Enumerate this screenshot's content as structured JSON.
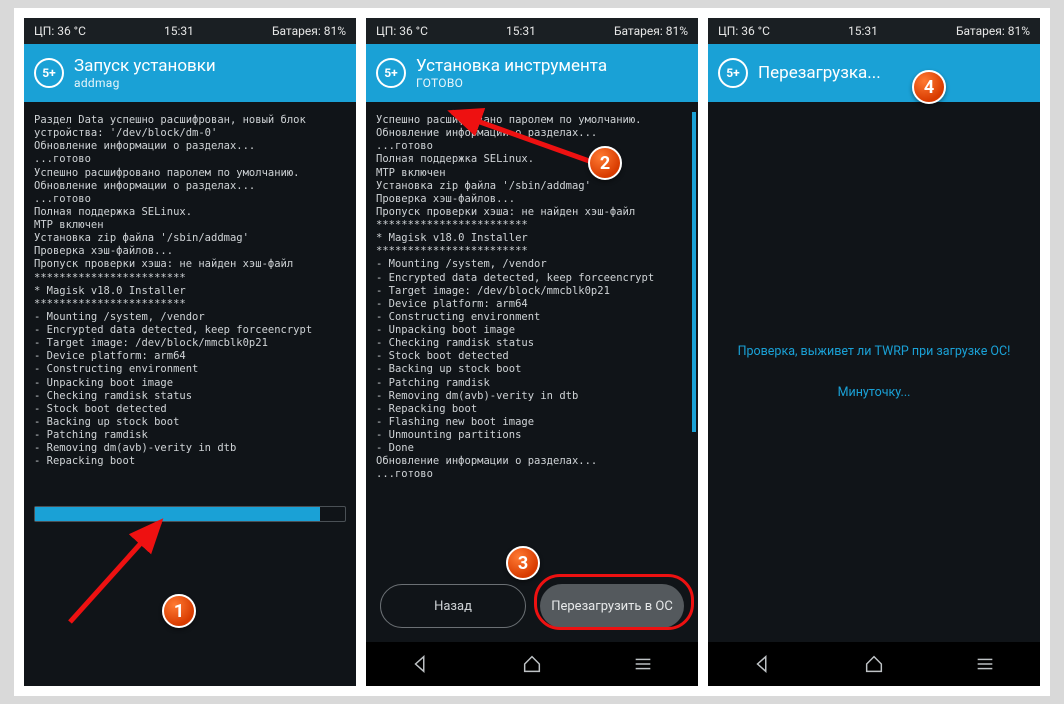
{
  "status": {
    "cpu": "ЦП: 36 °C",
    "time": "15:31",
    "battery": "Батарея: 81%"
  },
  "badge": "5+",
  "nav": {
    "back": "back",
    "home": "home",
    "recent": "recent"
  },
  "annotations": {
    "n1": "1",
    "n2": "2",
    "n3": "3",
    "n4": "4"
  },
  "screen1": {
    "title": "Запуск установки",
    "subtitle": "addmag",
    "log": "Раздел Data успешно расшифрован, новый блок\nустройства: '/dev/block/dm-0'\nОбновление информации о разделах...\n...готово\nУспешно расшифровано паролем по умолчанию.\nОбновление информации о разделах...\n...готово\nПолная поддержка SELinux.\nMTP включен\nУстановка zip файла '/sbin/addmag'\nПроверка хэш-файлов...\nПропуск проверки хэша: не найден хэш-файл\n************************\n* Magisk v18.0 Installer\n************************\n- Mounting /system, /vendor\n- Encrypted data detected, keep forceencrypt\n- Target image: /dev/block/mmcblk0p21\n- Device platform: arm64\n- Constructing environment\n- Unpacking boot image\n- Checking ramdisk status\n- Stock boot detected\n- Backing up stock boot\n- Patching ramdisk\n- Removing dm(avb)-verity in dtb\n- Repacking boot",
    "progress_pct": 92
  },
  "screen2": {
    "title": "Установка инструмента",
    "subtitle": "ГОТОВО",
    "log": "Успешно расшифровано паролем по умолчанию.\nОбновление информации о разделах...\n...готово\nПолная поддержка SELinux.\nMTP включен\nУстановка zip файла '/sbin/addmag'\nПроверка хэш-файлов...\nПропуск проверки хэша: не найден хэш-файл\n************************\n* Magisk v18.0 Installer\n************************\n- Mounting /system, /vendor\n- Encrypted data detected, keep forceencrypt\n- Target image: /dev/block/mmcblk0p21\n- Device platform: arm64\n- Constructing environment\n- Unpacking boot image\n- Checking ramdisk status\n- Stock boot detected\n- Backing up stock boot\n- Patching ramdisk\n- Removing dm(avb)-verity in dtb\n- Repacking boot\n- Flashing new boot image\n- Unmounting partitions\n- Done\nОбновление информации о разделах...\n...готово",
    "btn_back": "Назад",
    "btn_reboot": "Перезагрузить в ОС"
  },
  "screen3": {
    "title": "Перезагрузка...",
    "subtitle": "",
    "msg1": "Проверка, выживет ли TWRP при загрузке ОС!",
    "msg2": "Минуточку..."
  }
}
